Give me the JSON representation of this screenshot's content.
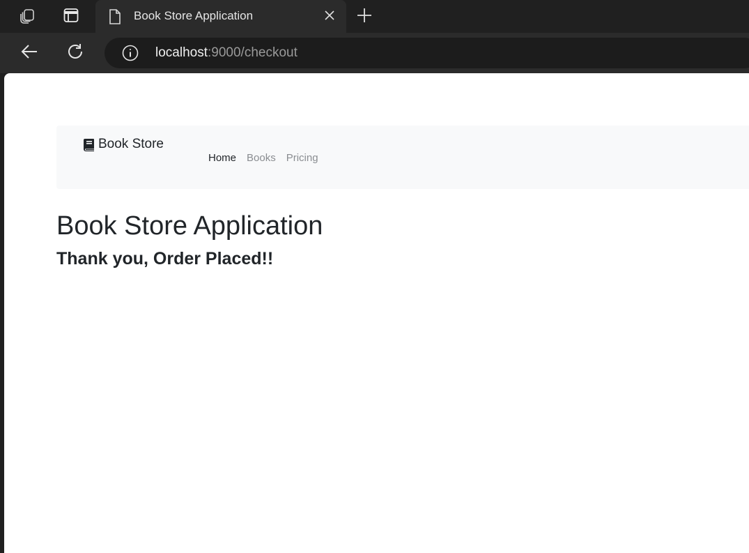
{
  "browser": {
    "tab": {
      "title": "Book Store Application"
    },
    "address": {
      "host": "localhost",
      "rest": ":9000/checkout"
    },
    "colors": {
      "chrome_bg": "#202020",
      "toolbar_bg": "#2b2b2b",
      "address_bg": "#1c1c1c"
    }
  },
  "page": {
    "navbar": {
      "brand_label": "Book Store",
      "brand_icon": "book-icon",
      "links": [
        {
          "label": "Home",
          "active": true
        },
        {
          "label": "Books",
          "active": false
        },
        {
          "label": "Pricing",
          "active": false
        }
      ]
    },
    "title": "Book Store Application",
    "subtitle": "Thank you, Order Placed!!"
  }
}
